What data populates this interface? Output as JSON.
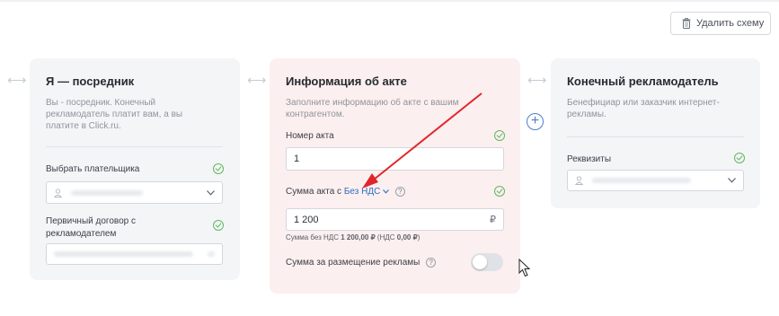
{
  "toolbar": {
    "delete_scheme_label": "Удалить схему"
  },
  "card_intermediary": {
    "title": "Я — посредник",
    "description": "Вы - посредник. Конечный рекламодатель платит вам, а вы платите в Click.ru.",
    "payer_label": "Выбрать плательщика",
    "contract_label": "Первичный договор с рекламодателем"
  },
  "card_act": {
    "title": "Информация об акте",
    "description": "Заполните информацию об акте с вашим контрагентом.",
    "act_number_label": "Номер акта",
    "act_number_value": "1",
    "act_sum_label_prefix": "Сумма акта с",
    "act_sum_nds_link": "Без НДС",
    "act_sum_value": "1 200",
    "currency": "₽",
    "note_prefix": "Сумма без НДС",
    "note_amount": "1 200,00 ₽",
    "note_vat_prefix": "(НДС",
    "note_vat_amount": "0,00 ₽",
    "note_vat_suffix": ")",
    "ad_sum_label": "Сумма за размещение рекламы"
  },
  "card_advertiser": {
    "title": "Конечный рекламодатель",
    "description": "Бенефициар или заказчик интернет-рекламы.",
    "requisites_label": "Реквизиты"
  },
  "colors": {
    "accent": "#2f6ec2",
    "success": "#5fb85f",
    "annotation_arrow": "#e0262b",
    "highlight_card": "#fcefef",
    "card": "#f4f5f7"
  }
}
